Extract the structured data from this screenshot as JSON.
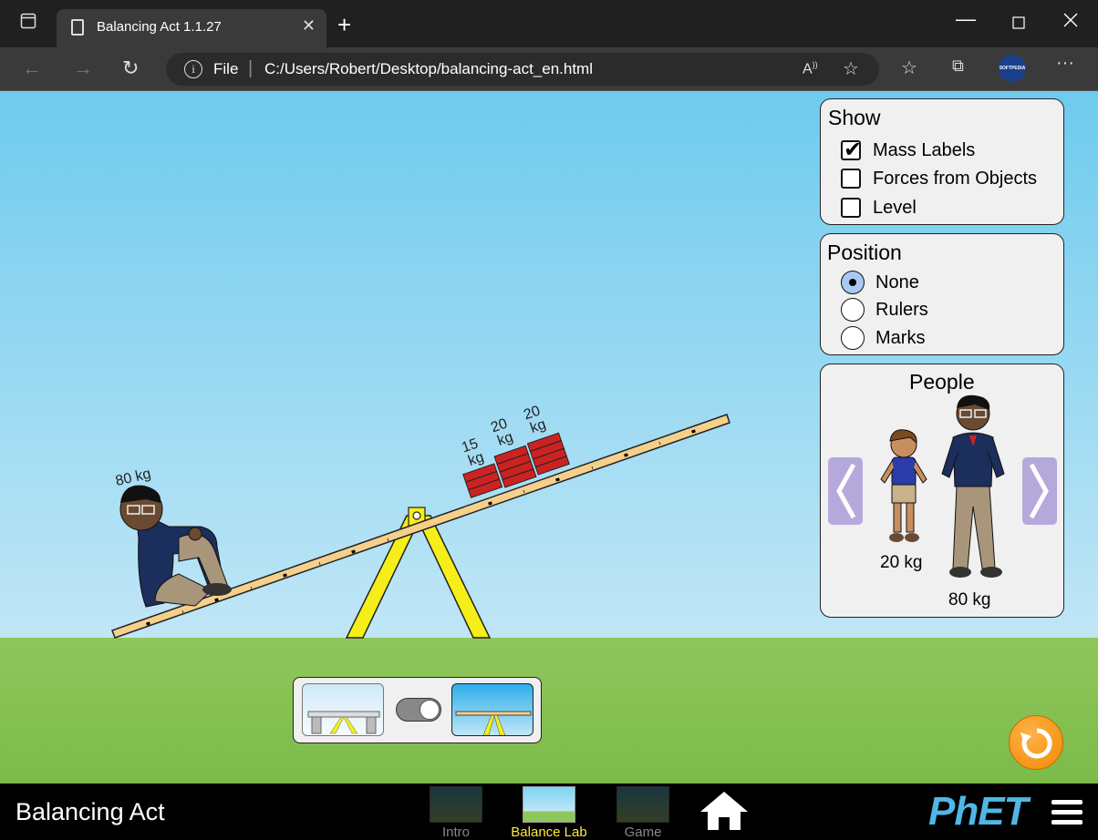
{
  "browser": {
    "tab_title": "Balancing Act 1.1.27",
    "tab_close": "✕",
    "new_tab": "+",
    "address_prefix": "File",
    "address_url": "C:/Users/Robert/Desktop/balancing-act_en.html",
    "profile_label": "SOFTPEDIA"
  },
  "show_panel": {
    "title": "Show",
    "options": [
      {
        "label": "Mass Labels",
        "checked": true
      },
      {
        "label": "Forces from Objects",
        "checked": false
      },
      {
        "label": "Level",
        "checked": false
      }
    ]
  },
  "position_panel": {
    "title": "Position",
    "options": [
      {
        "label": "None",
        "selected": true
      },
      {
        "label": "Rulers",
        "selected": false
      },
      {
        "label": "Marks",
        "selected": false
      }
    ]
  },
  "people_panel": {
    "title": "People",
    "people": [
      {
        "label": "20 kg"
      },
      {
        "label": "80 kg"
      }
    ]
  },
  "plank_objects": {
    "person_mass": "80 kg",
    "bricks": [
      {
        "value": "15",
        "unit": "kg"
      },
      {
        "value": "20",
        "unit": "kg"
      },
      {
        "value": "20",
        "unit": "kg"
      }
    ]
  },
  "navbar": {
    "sim_title": "Balancing Act",
    "screens": [
      {
        "label": "Intro",
        "active": false
      },
      {
        "label": "Balance Lab",
        "active": true
      },
      {
        "label": "Game",
        "active": false
      }
    ],
    "logo": "PhET",
    "watermark": "SOFTPEDIA"
  },
  "colors": {
    "sky_top": "#6ecbee",
    "ground": "#8fc65b",
    "plank": "#f5cf8c",
    "fulcrum": "#f5ee19",
    "brick": "#cc2222",
    "arrow": "#b5a9dc",
    "reset": "#f08a00",
    "active_screen": "#ffeb3b"
  }
}
